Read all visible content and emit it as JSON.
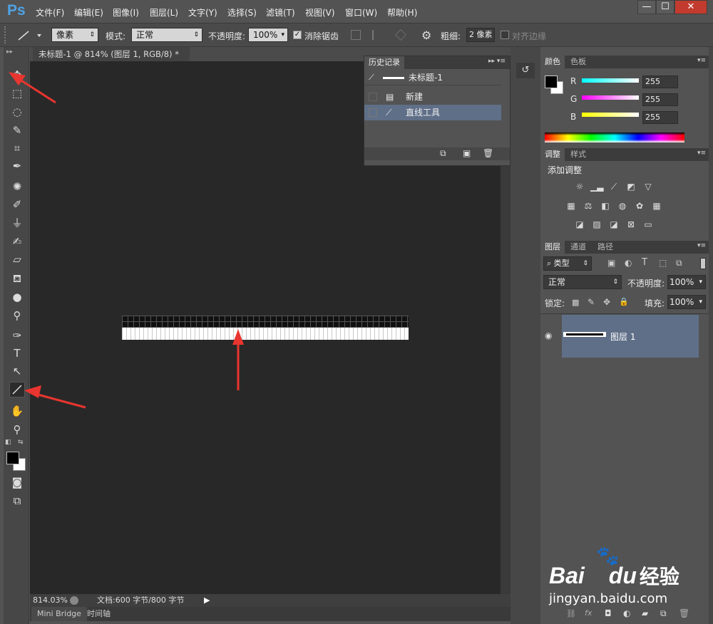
{
  "app": {
    "logo": "Ps"
  },
  "menus": [
    "文件(F)",
    "编辑(E)",
    "图像(I)",
    "图层(L)",
    "文字(Y)",
    "选择(S)",
    "滤镜(T)",
    "视图(V)",
    "窗口(W)",
    "帮助(H)"
  ],
  "window_controls": {
    "minimize": "—",
    "maximize": "☐",
    "close": "✕"
  },
  "options": {
    "mode_select": "像素",
    "mode_label": "模式:",
    "blend_mode": "正常",
    "opacity_label": "不透明度:",
    "opacity_value": "100%",
    "antialias_label": "消除锯齿",
    "weight_label": "粗细:",
    "weight_value": "2 像素",
    "align_edges_label": "对齐边缘"
  },
  "document": {
    "tab_title": "未标题-1 @ 814% (图层 1, RGB/8) *",
    "tab_close": "×",
    "zoom": "814.03%",
    "doc_info": "文档:600 字节/800 字节"
  },
  "bottom_tabs": {
    "mini_bridge": "Mini Bridge",
    "timeline": "时间轴"
  },
  "history": {
    "tab": "历史记录",
    "snapshot": "未标题-1",
    "items": [
      "新建",
      "直线工具"
    ]
  },
  "color_panel": {
    "tabs": [
      "颜色",
      "色板"
    ],
    "channels": [
      {
        "label": "R",
        "value": "255",
        "color": "#00ffff"
      },
      {
        "label": "G",
        "value": "255",
        "color": "#ff00ff"
      },
      {
        "label": "B",
        "value": "255",
        "color": "#ffff00"
      }
    ]
  },
  "adjust_panel": {
    "tabs": [
      "调整",
      "样式"
    ],
    "title": "添加调整"
  },
  "layers_panel": {
    "tabs": [
      "图层",
      "通道",
      "路径"
    ],
    "filter_type": "类型",
    "blend_mode": "正常",
    "opacity_label": "不透明度:",
    "opacity_value": "100%",
    "lock_label": "锁定:",
    "fill_label": "填充:",
    "fill_value": "100%",
    "layer_name": "图层 1"
  },
  "watermark": {
    "brand_a": "Bai",
    "brand_b": "du",
    "brand_c": "经验",
    "url": "jingyan.baidu.com"
  },
  "colors": {
    "accent_red": "#e8352f",
    "selection": "#5f6f88"
  }
}
